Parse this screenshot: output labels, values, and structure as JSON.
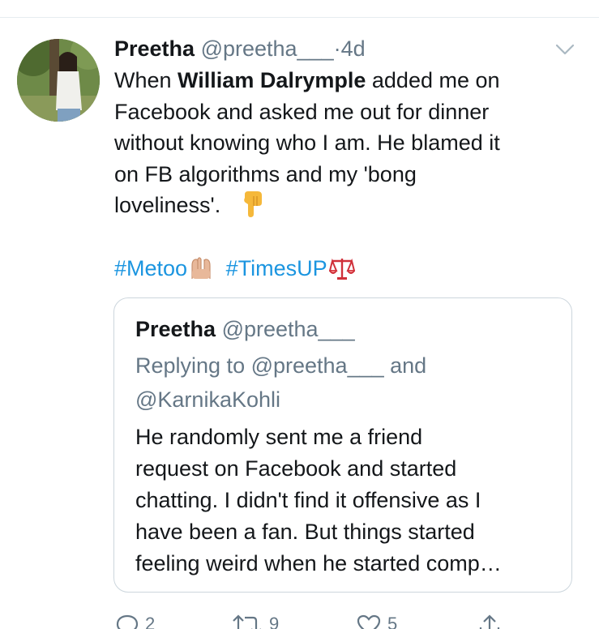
{
  "tweet": {
    "author_name": "Preetha",
    "author_handle": "@preetha___",
    "separator": "·",
    "time": "4d",
    "text_lines": [
      {
        "before": "When ",
        "bold": "William Dalrymple",
        "after": " added me on"
      },
      "Facebook and asked me out for dinner",
      "without knowing who I am. He blamed it",
      "on FB algorithms and my 'bong",
      "loveliness'."
    ],
    "hashtags": [
      "#Metoo",
      "#TimesUP"
    ],
    "icons": {
      "caret": "chevron-down-icon",
      "pointing_emoji": "backhand-index-pointing-down-icon",
      "raised_hands_emoji": "raised-hands-icon",
      "scales_emoji": "balance-scale-icon"
    }
  },
  "quoted_tweet": {
    "author_name": "Preetha",
    "author_handle": "@preetha___",
    "reply_lines": [
      "Replying to @preetha___ and",
      "@KarnikaKohli"
    ],
    "text_lines": [
      "He randomly sent me a friend",
      "request on Facebook and started",
      "chatting. I didn't find it offensive as I",
      "have been a fan. But things started",
      "feeling weird when he started comp…"
    ]
  },
  "actions": {
    "reply_count": "2",
    "retweet_count": "9",
    "like_count": "5",
    "icons": [
      "reply-icon",
      "retweet-icon",
      "like-icon",
      "share-icon"
    ]
  },
  "colors": {
    "link": "#1b95e0",
    "secondary_text": "#657786",
    "border": "#ccd6dd"
  }
}
